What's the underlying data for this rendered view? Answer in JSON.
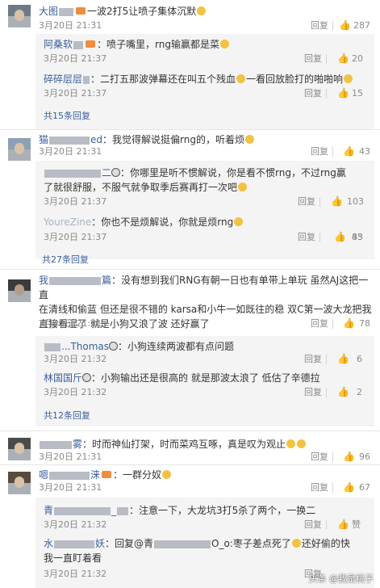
{
  "ui": {
    "reply": "回复",
    "thumb_glyph": "👍"
  },
  "threads": [
    {
      "name_a": "大图",
      "text": "一波2打5让喷子集体沉默",
      "time": "3月20日 21:31",
      "likes": "287",
      "replies": [
        {
          "name_a": "阿桑软",
          "text": "：喷子嘴里，rng输赢都是菜",
          "time": "3月20日 21:37",
          "likes": "20"
        },
        {
          "name_a": "碎碎层层",
          "text": "：二打五那波弹幕还在叫五个残血",
          "text2": "一看回放脸打的啪啪响",
          "time": "3月20日 21:37",
          "likes": "15"
        }
      ],
      "more": "共15条回复"
    },
    {
      "name_a": "猫",
      "name_b": "ed",
      "text": "：我觉得解说挺偏rng的，听着烦",
      "time": "3月20日 21:31",
      "likes": "43",
      "replies": [
        {
          "name_b": "二",
          "text": "：你哪里是听不惯解说，你是看不惯rng，不过rng赢",
          "text2": "了就很舒服，不服气就争取季后赛再打一次吧",
          "time": "3月20日 21:37",
          "likes": "103"
        },
        {
          "name_a": "YoureZine",
          "text": "：你也不是烦解说，你就是烦rng",
          "time": "3月20日 21:37",
          "likes": "85"
        }
      ],
      "more": "共27条回复"
    },
    {
      "name_a": "我",
      "name_b": "篇",
      "text": "：没有想到我们RNG有朝一日也有单带上单玩 虽然AJ这把一直",
      "text2": "在清线和偷蓝 但还是很不错的 karsa和小牛一如既往的稳 双C第一波大龙把我",
      "text3": "直接看湿了 就是小狗又浪了波 还好赢了",
      "time": "3月20日 21:31",
      "likes": "78",
      "replies": [
        {
          "name_a": "...Thomas",
          "text": "：小狗连续两波都有点问题",
          "time": "3月20日 21:32",
          "likes": "6"
        },
        {
          "name_a": "林国国斤",
          "text": "：小狗输出还是很高的 就是那波太浪了 低估了辛德拉",
          "time": "3月20日 21:32",
          "likes": "2"
        }
      ],
      "more": "共12条回复"
    },
    {
      "name_a": "雾",
      "text": "：时而神仙打架，时而菜鸡互啄，真是叹为观止",
      "time": "3月20日 21:31",
      "likes": "96"
    },
    {
      "name_a": "嗯",
      "name_b": "涞",
      "text": "：一群分奴",
      "time": "3月20日 21:31",
      "likes": "67",
      "replies": [
        {
          "name_a": "青",
          "name_b": "_",
          "text": "：注意一下，大龙坑3打5杀了两个，一换二",
          "time": "3月20日 21:32",
          "likes": "赞"
        },
        {
          "name_a": "水",
          "name_b": "妖",
          "text": "：回复@青",
          "text_b": "O_o:枣子差点死了",
          "text_c": "还好偷的快",
          "text2": "我一直盯着看",
          "time": "3月20日 21:32",
          "likes": ""
        }
      ]
    }
  ],
  "watermark": "头条 @我是桃子"
}
